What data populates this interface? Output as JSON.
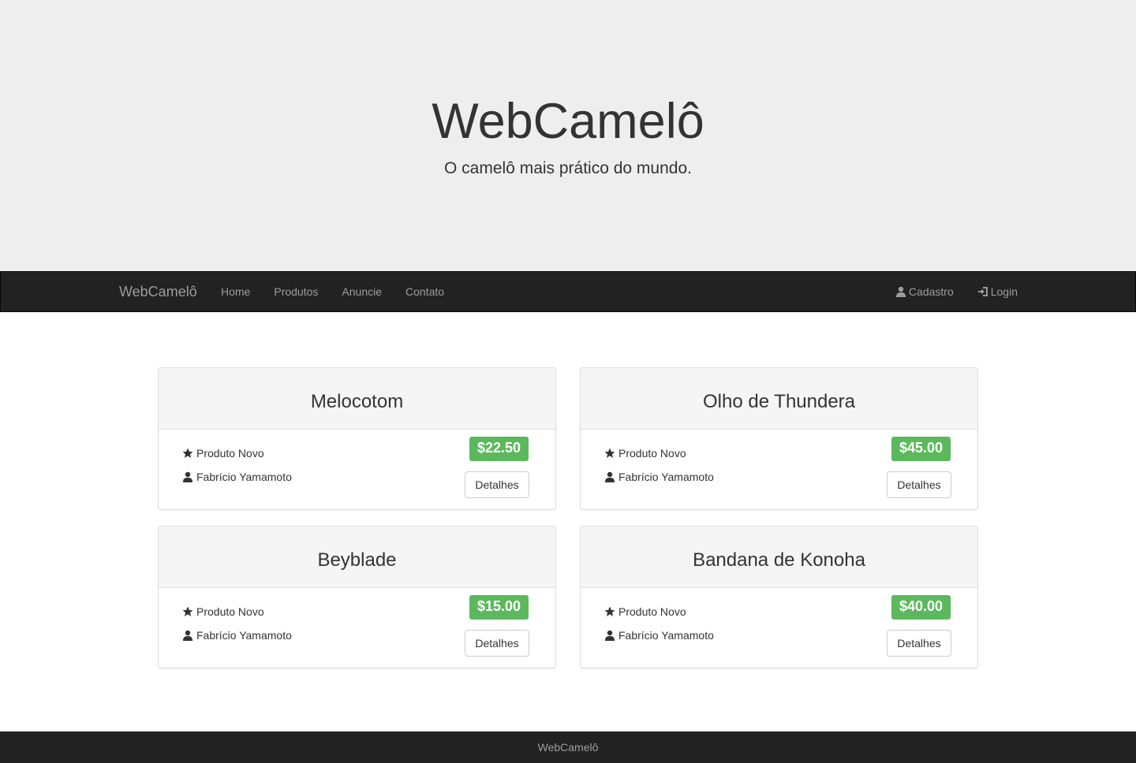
{
  "hero": {
    "title": "WebCamelô",
    "subtitle": "O camelô mais prático do mundo."
  },
  "navbar": {
    "brand": "WebCamelô",
    "links": [
      {
        "label": "Home"
      },
      {
        "label": "Produtos"
      },
      {
        "label": "Anuncie"
      },
      {
        "label": "Contato"
      }
    ],
    "right": [
      {
        "label": "Cadastro",
        "icon": "user-icon"
      },
      {
        "label": "Login",
        "icon": "login-icon"
      }
    ]
  },
  "products": [
    {
      "name": "Melocotom",
      "condition": "Produto Novo",
      "seller": "Fabrício Yamamoto",
      "price": "$22.50",
      "button": "Detalhes"
    },
    {
      "name": "Olho de Thundera",
      "condition": "Produto Novo",
      "seller": "Fabrício Yamamoto",
      "price": "$45.00",
      "button": "Detalhes"
    },
    {
      "name": "Beyblade",
      "condition": "Produto Novo",
      "seller": "Fabrício Yamamoto",
      "price": "$15.00",
      "button": "Detalhes"
    },
    {
      "name": "Bandana de Konoha",
      "condition": "Produto Novo",
      "seller": "Fabrício Yamamoto",
      "price": "$40.00",
      "button": "Detalhes"
    }
  ],
  "footer": {
    "text": "WebCamelô"
  },
  "colors": {
    "navbar_bg": "#222222",
    "hero_bg": "#eeeeee",
    "price_badge": "#5cb85c"
  }
}
